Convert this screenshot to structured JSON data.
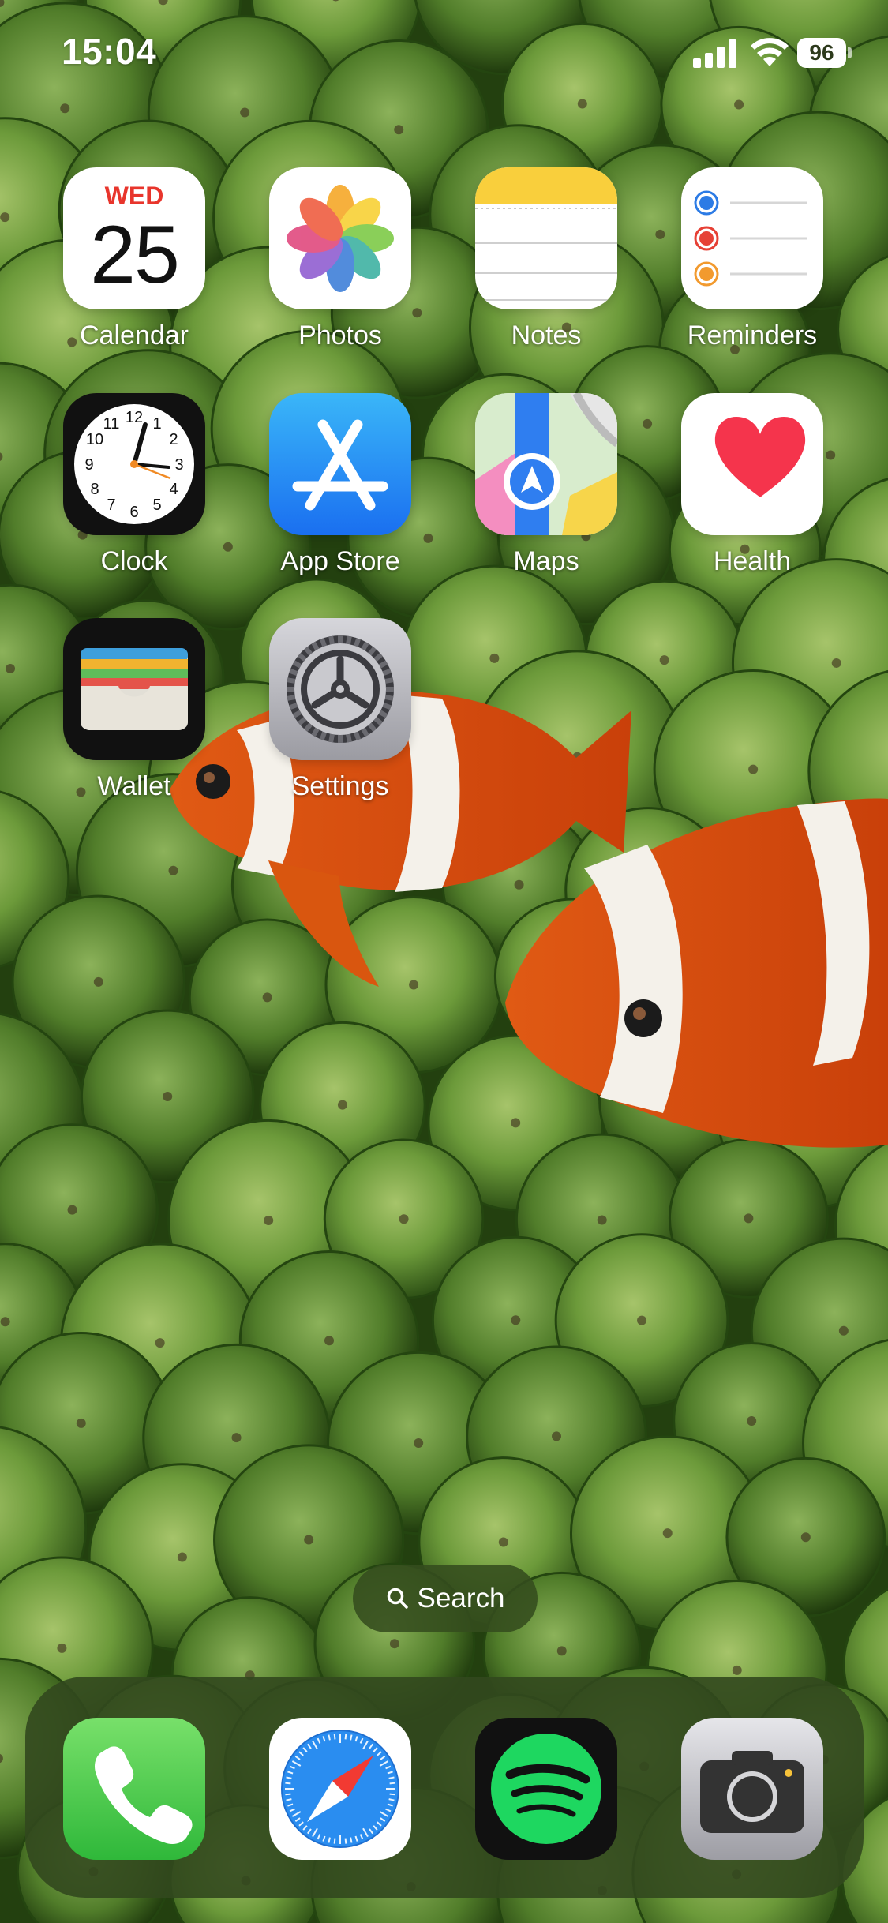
{
  "status_bar": {
    "time": "15:04",
    "battery_level": "96",
    "icons": [
      "signal-icon",
      "wifi-icon",
      "battery-icon"
    ]
  },
  "apps": [
    {
      "label": "Calendar",
      "icon": "calendar-icon",
      "day": "WED",
      "date": "25"
    },
    {
      "label": "Photos",
      "icon": "photos-icon"
    },
    {
      "label": "Notes",
      "icon": "notes-icon"
    },
    {
      "label": "Reminders",
      "icon": "reminders-icon"
    },
    {
      "label": "Clock",
      "icon": "clock-icon"
    },
    {
      "label": "App Store",
      "icon": "app-store-icon"
    },
    {
      "label": "Maps",
      "icon": "maps-icon"
    },
    {
      "label": "Health",
      "icon": "health-icon"
    },
    {
      "label": "Wallet",
      "icon": "wallet-icon"
    },
    {
      "label": "Settings",
      "icon": "settings-icon"
    }
  ],
  "search": {
    "label": "Search",
    "icon": "search-icon"
  },
  "dock": [
    {
      "name": "Phone",
      "icon": "phone-icon"
    },
    {
      "name": "Safari",
      "icon": "safari-icon"
    },
    {
      "name": "Spotify",
      "icon": "spotify-icon"
    },
    {
      "name": "Camera",
      "icon": "camera-icon"
    }
  ],
  "colors": {
    "calendar_red": "#e8352c",
    "dock_background": "#32481e",
    "spotify_green": "#1ed760",
    "appstore_blue": "#1a8cf5"
  }
}
